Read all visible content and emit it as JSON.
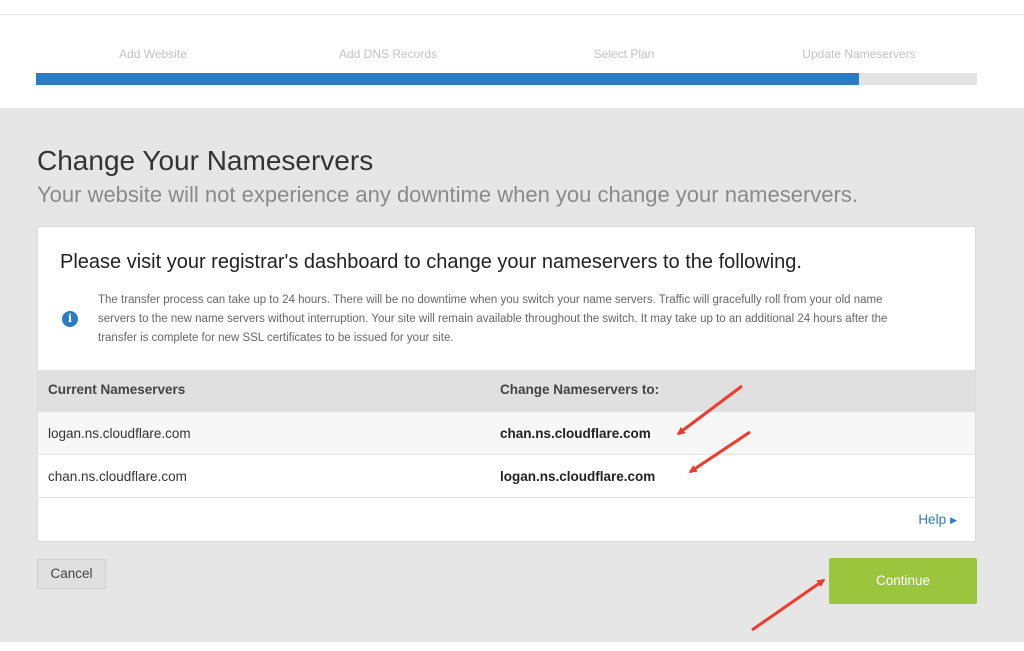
{
  "wizard": {
    "steps": [
      "Add Website",
      "Add DNS Records",
      "Select Plan",
      "Update Nameservers"
    ],
    "progress_fraction": 0.875
  },
  "page": {
    "title": "Change Your Nameservers",
    "subtitle": "Your website will not experience any downtime when you change your nameservers."
  },
  "card": {
    "heading": "Please visit your registrar's dashboard to change your nameservers to the following.",
    "info_icon": "info-circle-icon",
    "info_text": "The transfer process can take up to 24 hours. There will be no downtime when you switch your name servers. Traffic will gracefully roll from your old name servers to the new name servers without interruption. Your site will remain available throughout the switch. It may take up to an additional 24 hours after the transfer is complete for new SSL certificates to be issued for your site."
  },
  "table": {
    "headers": [
      "Current Nameservers",
      "Change Nameservers to:"
    ],
    "rows": [
      {
        "current": "logan.ns.cloudflare.com",
        "new": "chan.ns.cloudflare.com"
      },
      {
        "current": "chan.ns.cloudflare.com",
        "new": "logan.ns.cloudflare.com"
      }
    ]
  },
  "help": {
    "label": "Help",
    "icon": "caret-right-icon"
  },
  "actions": {
    "cancel_label": "Cancel",
    "continue_label": "Continue"
  },
  "colors": {
    "accent_blue": "#2c7cc1",
    "continue_green": "#9bc53d",
    "annotation_red": "#f03a2e",
    "panel_gray": "#e6e6e6"
  }
}
